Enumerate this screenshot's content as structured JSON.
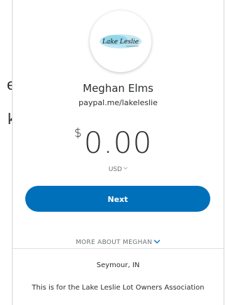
{
  "left_fragments": [
    "e",
    "k"
  ],
  "profile": {
    "logo_text": "Lake Leslie",
    "name": "Meghan Elms",
    "handle": "paypal.me/lakeleslie"
  },
  "payment": {
    "currency_symbol": "$",
    "amount": "0.00",
    "currency_code": "USD",
    "next_label": "Next"
  },
  "about": {
    "toggle_label": "MORE ABOUT MEGHAN",
    "location": "Seymour, IN",
    "description": "This is for the Lake Leslie Lot Owners Association"
  },
  "colors": {
    "primary_button": "#0070ba",
    "text": "#2c2e2f",
    "muted_text": "#6c7378",
    "link_chevron": "#0070ba"
  }
}
